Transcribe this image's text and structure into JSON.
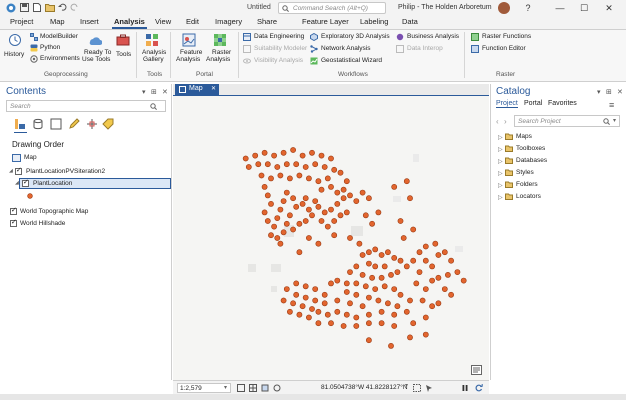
{
  "titlebar": {
    "project_title": "Untitled",
    "command_search_placeholder": "Command Search (Alt+Q)",
    "user": "Philip - The Holden Arboretum",
    "help": "?",
    "minimize": "—",
    "maximize": "☐",
    "close": "✕"
  },
  "tabs": [
    "Project",
    "Map",
    "Insert",
    "Analysis",
    "View",
    "Edit",
    "Imagery",
    "Share",
    "Feature Layer",
    "Labeling",
    "Data"
  ],
  "active_tab": "Analysis",
  "ribbon": {
    "history": "History",
    "modelbuilder": "ModelBuilder",
    "python": "Python",
    "environments": "Environments",
    "ready_to_use_1": "Ready To",
    "ready_to_use_2": "Use Tools",
    "tools": "Tools",
    "analysis_gallery_1": "Analysis",
    "analysis_gallery_2": "Gallery",
    "feature_analysis_1": "Feature",
    "feature_analysis_2": "Analysis",
    "raster_analysis_1": "Raster",
    "raster_analysis_2": "Analysis",
    "data_engineering": "Data Engineering",
    "suitability_modeler": "Suitability Modeler",
    "visibility_analysis": "Visibility Analysis",
    "exploratory_3d": "Exploratory 3D Analysis",
    "network_analysis": "Network Analysis",
    "geostatistical_wizard": "Geostatistical Wizard",
    "business_analysis": "Business Analysis",
    "data_interop": "Data Interop",
    "raster_functions": "Raster Functions",
    "function_editor": "Function Editor",
    "groups": {
      "geoprocessing": "Geoprocessing",
      "tools": "Tools",
      "portal": "Portal",
      "workflows": "Workflows",
      "raster": "Raster"
    }
  },
  "contents": {
    "title": "Contents",
    "search_placeholder": "Search",
    "drawing_order": "Drawing Order",
    "map": "Map",
    "layers": [
      "PlantLocationPVSiteration2",
      "PlantLocation",
      "World Topographic Map",
      "World Hillshade"
    ]
  },
  "map_tab": "Map",
  "catalog": {
    "title": "Catalog",
    "tabs": [
      "Project",
      "Portal",
      "Favorites"
    ],
    "search_placeholder": "Search Project",
    "items": [
      "Maps",
      "Toolboxes",
      "Databases",
      "Styles",
      "Folders",
      "Locators"
    ]
  },
  "status": {
    "scale": "1:2,579",
    "coords": "81.0504738°W 41.8228127°N"
  },
  "colors": {
    "accent": "#2b5a9a",
    "point_fill": "#e2652e",
    "point_stroke": "#9a3a12"
  },
  "points": [
    [
      0.23,
      0.22
    ],
    [
      0.26,
      0.21
    ],
    [
      0.29,
      0.2
    ],
    [
      0.32,
      0.21
    ],
    [
      0.35,
      0.2
    ],
    [
      0.38,
      0.19
    ],
    [
      0.41,
      0.21
    ],
    [
      0.44,
      0.2
    ],
    [
      0.47,
      0.21
    ],
    [
      0.5,
      0.22
    ],
    [
      0.24,
      0.25
    ],
    [
      0.27,
      0.24
    ],
    [
      0.3,
      0.24
    ],
    [
      0.33,
      0.25
    ],
    [
      0.36,
      0.24
    ],
    [
      0.39,
      0.24
    ],
    [
      0.42,
      0.25
    ],
    [
      0.45,
      0.24
    ],
    [
      0.48,
      0.25
    ],
    [
      0.51,
      0.26
    ],
    [
      0.28,
      0.28
    ],
    [
      0.31,
      0.29
    ],
    [
      0.34,
      0.28
    ],
    [
      0.37,
      0.29
    ],
    [
      0.4,
      0.28
    ],
    [
      0.43,
      0.29
    ],
    [
      0.46,
      0.3
    ],
    [
      0.49,
      0.29
    ],
    [
      0.53,
      0.27
    ],
    [
      0.55,
      0.3
    ],
    [
      0.29,
      0.32
    ],
    [
      0.3,
      0.35
    ],
    [
      0.31,
      0.38
    ],
    [
      0.29,
      0.41
    ],
    [
      0.3,
      0.44
    ],
    [
      0.32,
      0.46
    ],
    [
      0.33,
      0.43
    ],
    [
      0.34,
      0.4
    ],
    [
      0.35,
      0.37
    ],
    [
      0.36,
      0.34
    ],
    [
      0.38,
      0.36
    ],
    [
      0.39,
      0.39
    ],
    [
      0.37,
      0.42
    ],
    [
      0.36,
      0.45
    ],
    [
      0.38,
      0.47
    ],
    [
      0.35,
      0.48
    ],
    [
      0.33,
      0.5
    ],
    [
      0.31,
      0.49
    ],
    [
      0.4,
      0.45
    ],
    [
      0.42,
      0.44
    ],
    [
      0.44,
      0.42
    ],
    [
      0.43,
      0.4
    ],
    [
      0.41,
      0.38
    ],
    [
      0.42,
      0.36
    ],
    [
      0.45,
      0.37
    ],
    [
      0.47,
      0.33
    ],
    [
      0.5,
      0.32
    ],
    [
      0.52,
      0.34
    ],
    [
      0.54,
      0.33
    ],
    [
      0.46,
      0.39
    ],
    [
      0.48,
      0.41
    ],
    [
      0.5,
      0.4
    ],
    [
      0.52,
      0.38
    ],
    [
      0.54,
      0.36
    ],
    [
      0.56,
      0.35
    ],
    [
      0.47,
      0.44
    ],
    [
      0.49,
      0.46
    ],
    [
      0.51,
      0.44
    ],
    [
      0.53,
      0.42
    ],
    [
      0.55,
      0.41
    ],
    [
      0.58,
      0.37
    ],
    [
      0.6,
      0.34
    ],
    [
      0.62,
      0.36
    ],
    [
      0.61,
      0.42
    ],
    [
      0.63,
      0.45
    ],
    [
      0.65,
      0.41
    ],
    [
      0.7,
      0.32
    ],
    [
      0.74,
      0.3
    ],
    [
      0.75,
      0.36
    ],
    [
      0.72,
      0.44
    ],
    [
      0.76,
      0.47
    ],
    [
      0.73,
      0.5
    ],
    [
      0.34,
      0.52
    ],
    [
      0.4,
      0.55
    ],
    [
      0.43,
      0.5
    ],
    [
      0.46,
      0.52
    ],
    [
      0.51,
      0.49
    ],
    [
      0.56,
      0.5
    ],
    [
      0.59,
      0.52
    ],
    [
      0.6,
      0.56
    ],
    [
      0.62,
      0.55
    ],
    [
      0.64,
      0.54
    ],
    [
      0.66,
      0.56
    ],
    [
      0.68,
      0.55
    ],
    [
      0.7,
      0.57
    ],
    [
      0.72,
      0.58
    ],
    [
      0.62,
      0.59
    ],
    [
      0.64,
      0.6
    ],
    [
      0.67,
      0.6
    ],
    [
      0.58,
      0.6
    ],
    [
      0.56,
      0.62
    ],
    [
      0.6,
      0.63
    ],
    [
      0.63,
      0.64
    ],
    [
      0.66,
      0.64
    ],
    [
      0.69,
      0.63
    ],
    [
      0.71,
      0.62
    ],
    [
      0.74,
      0.6
    ],
    [
      0.76,
      0.58
    ],
    [
      0.78,
      0.62
    ],
    [
      0.8,
      0.58
    ],
    [
      0.82,
      0.6
    ],
    [
      0.84,
      0.56
    ],
    [
      0.86,
      0.55
    ],
    [
      0.8,
      0.53
    ],
    [
      0.78,
      0.55
    ],
    [
      0.83,
      0.52
    ],
    [
      0.77,
      0.66
    ],
    [
      0.8,
      0.68
    ],
    [
      0.82,
      0.65
    ],
    [
      0.84,
      0.64
    ],
    [
      0.87,
      0.63
    ],
    [
      0.88,
      0.58
    ],
    [
      0.86,
      0.68
    ],
    [
      0.79,
      0.72
    ],
    [
      0.82,
      0.74
    ],
    [
      0.75,
      0.72
    ],
    [
      0.72,
      0.7
    ],
    [
      0.7,
      0.68
    ],
    [
      0.67,
      0.67
    ],
    [
      0.64,
      0.68
    ],
    [
      0.61,
      0.67
    ],
    [
      0.58,
      0.66
    ],
    [
      0.55,
      0.66
    ],
    [
      0.52,
      0.65
    ],
    [
      0.5,
      0.66
    ],
    [
      0.55,
      0.69
    ],
    [
      0.58,
      0.7
    ],
    [
      0.62,
      0.71
    ],
    [
      0.65,
      0.72
    ],
    [
      0.68,
      0.73
    ],
    [
      0.71,
      0.74
    ],
    [
      0.6,
      0.74
    ],
    [
      0.56,
      0.73
    ],
    [
      0.52,
      0.72
    ],
    [
      0.48,
      0.7
    ],
    [
      0.45,
      0.68
    ],
    [
      0.42,
      0.67
    ],
    [
      0.39,
      0.66
    ],
    [
      0.36,
      0.68
    ],
    [
      0.39,
      0.7
    ],
    [
      0.42,
      0.71
    ],
    [
      0.45,
      0.72
    ],
    [
      0.48,
      0.73
    ],
    [
      0.44,
      0.75
    ],
    [
      0.41,
      0.74
    ],
    [
      0.38,
      0.73
    ],
    [
      0.35,
      0.72
    ],
    [
      0.37,
      0.76
    ],
    [
      0.4,
      0.77
    ],
    [
      0.43,
      0.78
    ],
    [
      0.46,
      0.76
    ],
    [
      0.49,
      0.77
    ],
    [
      0.52,
      0.76
    ],
    [
      0.55,
      0.77
    ],
    [
      0.58,
      0.78
    ],
    [
      0.62,
      0.77
    ],
    [
      0.66,
      0.76
    ],
    [
      0.7,
      0.77
    ],
    [
      0.74,
      0.76
    ],
    [
      0.46,
      0.8
    ],
    [
      0.5,
      0.8
    ],
    [
      0.54,
      0.81
    ],
    [
      0.58,
      0.81
    ],
    [
      0.62,
      0.8
    ],
    [
      0.66,
      0.8
    ],
    [
      0.7,
      0.81
    ],
    [
      0.76,
      0.8
    ],
    [
      0.8,
      0.78
    ],
    [
      0.84,
      0.73
    ],
    [
      0.88,
      0.7
    ],
    [
      0.9,
      0.62
    ],
    [
      0.92,
      0.65
    ],
    [
      0.75,
      0.85
    ],
    [
      0.62,
      0.86
    ],
    [
      0.69,
      0.88
    ],
    [
      0.8,
      0.84
    ]
  ]
}
